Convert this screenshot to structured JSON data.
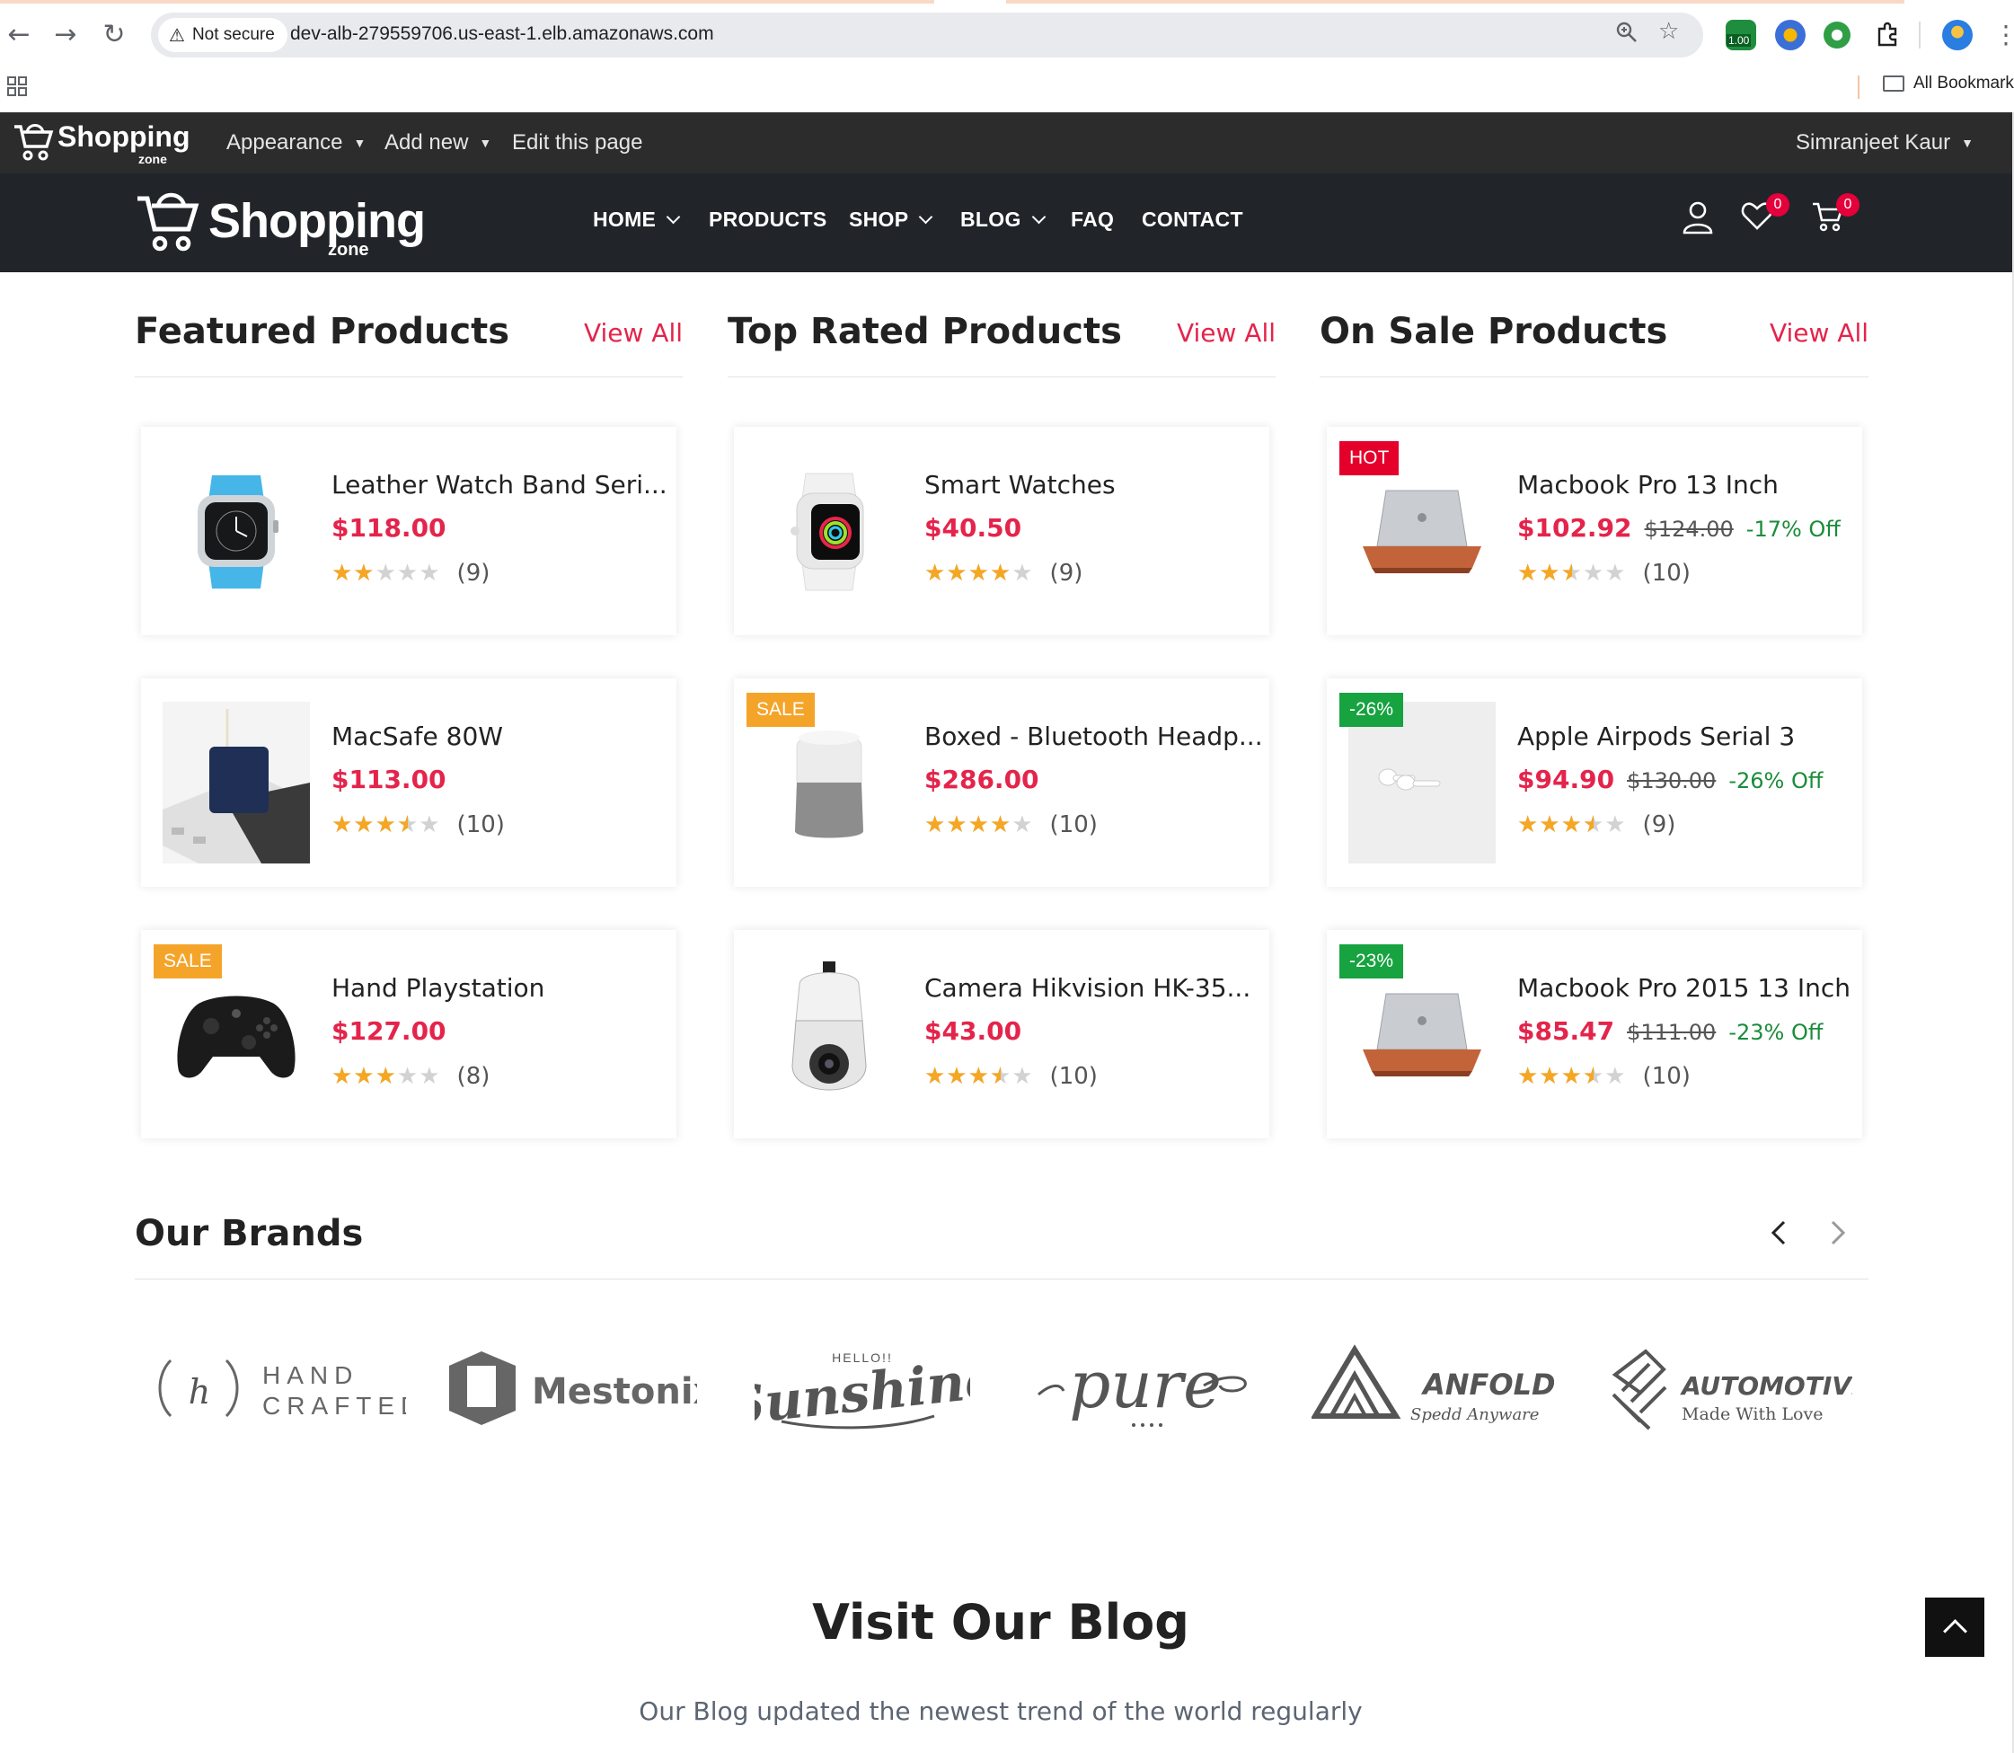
{
  "browser": {
    "security_label": "Not secure",
    "url": "dev-alb-279559706.us-east-1.elb.amazonaws.com",
    "ext_badge": "1.00",
    "all_bookmarks": "All Bookmarks"
  },
  "admin_bar": {
    "logo_word": "Shopping",
    "logo_sub": "zone",
    "appearance": "Appearance",
    "add_new": "Add new",
    "edit_page": "Edit this page",
    "user": "Simranjeet Kaur"
  },
  "header": {
    "logo_word": "Shopping",
    "logo_sub": "zone",
    "nav": [
      "HOME",
      "PRODUCTS",
      "SHOP",
      "BLOG",
      "FAQ",
      "CONTACT"
    ],
    "wishlist_count": "0",
    "cart_count": "0"
  },
  "sections": [
    {
      "title": "Featured Products",
      "view_all": "View All",
      "products": [
        {
          "name": "Leather Watch Band Seri...",
          "price": "$118.00",
          "old_price": "",
          "off": "",
          "rating": 2,
          "reviews": "(9)",
          "tag": "",
          "image": "blue-smartwatch"
        },
        {
          "name": "MacSafe 80W",
          "price": "$113.00",
          "old_price": "",
          "off": "",
          "rating": 3.5,
          "reviews": "(10)",
          "tag": "",
          "image": "charger-photo"
        },
        {
          "name": "Hand Playstation",
          "price": "$127.00",
          "old_price": "",
          "off": "",
          "rating": 3,
          "reviews": "(8)",
          "tag": "SALE",
          "image": "gamepad"
        }
      ]
    },
    {
      "title": "Top Rated Products",
      "view_all": "View All",
      "products": [
        {
          "name": "Smart Watches",
          "price": "$40.50",
          "old_price": "",
          "off": "",
          "rating": 4,
          "reviews": "(9)",
          "tag": "",
          "image": "white-smartwatch"
        },
        {
          "name": "Boxed - Bluetooth Headp...",
          "price": "$286.00",
          "old_price": "",
          "off": "",
          "rating": 4,
          "reviews": "(10)",
          "tag": "SALE",
          "image": "smart-speaker"
        },
        {
          "name": "Camera Hikvision HK-35...",
          "price": "$43.00",
          "old_price": "",
          "off": "",
          "rating": 3.5,
          "reviews": "(10)",
          "tag": "",
          "image": "dome-camera"
        }
      ]
    },
    {
      "title": "On Sale Products",
      "view_all": "View All",
      "products": [
        {
          "name": "Macbook Pro 13 Inch",
          "price": "$102.92",
          "old_price": "$124.00",
          "off": "-17% Off",
          "rating": 2.5,
          "reviews": "(10)",
          "tag": "HOT",
          "image": "laptop"
        },
        {
          "name": "Apple Airpods Serial 3",
          "price": "$94.90",
          "old_price": "$130.00",
          "off": "-26% Off",
          "rating": 3.5,
          "reviews": "(9)",
          "tag": "-26%",
          "image": "airpods-photo"
        },
        {
          "name": "Macbook Pro 2015 13 Inch",
          "price": "$85.47",
          "old_price": "$111.00",
          "off": "-23% Off",
          "rating": 3.5,
          "reviews": "(10)",
          "tag": "-23%",
          "image": "laptop"
        }
      ]
    }
  ],
  "brands": {
    "title": "Our Brands",
    "items": [
      {
        "name": "HAND CRAFTED",
        "line1": "HAND",
        "line2": "CRAFTED",
        "mark": "h"
      },
      {
        "name": "Mestonix",
        "line1": "Mestonix"
      },
      {
        "name": "Sunshine",
        "line1": "Sunshine",
        "line0": "HELLO!!"
      },
      {
        "name": "pure",
        "line1": "pure"
      },
      {
        "name": "ANFOLD",
        "line1": "ANFOLD",
        "line2": "Spedd Anyware"
      },
      {
        "name": "AUTOMOTIVE",
        "line1": "AUTOMOTIVE",
        "line2": "Made With Love"
      }
    ]
  },
  "blog": {
    "title": "Visit Our Blog",
    "subtitle": "Our Blog updated the newest trend of the world regularly"
  },
  "colors": {
    "accent": "#e4244b",
    "header_bg": "#212529",
    "admin_bg": "#2c2c2c",
    "star": "#f5a623",
    "hot": "#e4002b",
    "sale": "#f5a42a",
    "discount": "#16a340"
  }
}
